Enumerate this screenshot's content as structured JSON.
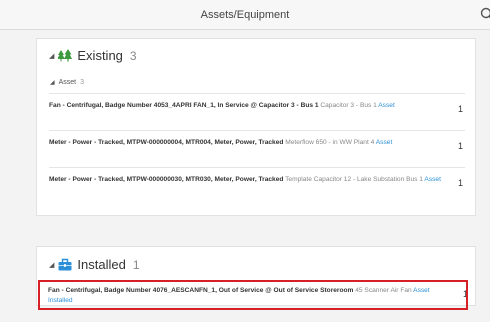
{
  "header": {
    "title": "Assets/Equipment",
    "search_icon": "search-icon"
  },
  "existing": {
    "title": "Existing",
    "count": "3",
    "icon": "tree-icon",
    "icon_color": "#3e9a3e",
    "subgroup": {
      "label": "Asset",
      "count": "3"
    },
    "rows": [
      {
        "bold": "Fan - Centrifugal, Badge Number 4053_4APRI FAN_1, In Service @ Capacitor 3 - Bus 1",
        "sub": " Capacitor 3 - Bus 1",
        "link": "Asset",
        "qty": "1"
      },
      {
        "bold": "Meter - Power - Tracked, MTPW-000000004, MTR004, Meter, Power, Tracked",
        "sub": " Meterflow 650 - in WW Plant 4",
        "link": "Asset",
        "qty": "1"
      },
      {
        "bold": "Meter - Power - Tracked, MTPW-000000030, MTR030, Meter, Power, Tracked",
        "sub": " Template Capacitor 12 - Lake Substation Bus 1",
        "link": "Asset",
        "qty": "1"
      }
    ]
  },
  "installed": {
    "title": "Installed",
    "count": "1",
    "icon": "toolbox-icon",
    "icon_color": "#2a8fd6",
    "rows": [
      {
        "bold": "Fan - Centrifugal, Badge Number 4076_AESCANFN_1, Out of Service @ Out of Service Storeroom",
        "sub": " 45 Scanner Air Fan",
        "link": "Asset Installed",
        "qty": "1"
      }
    ]
  },
  "colors": {
    "accent": "#2a8fd6",
    "highlight": "#d71f26",
    "existing_icon": "#3e9a3e"
  }
}
